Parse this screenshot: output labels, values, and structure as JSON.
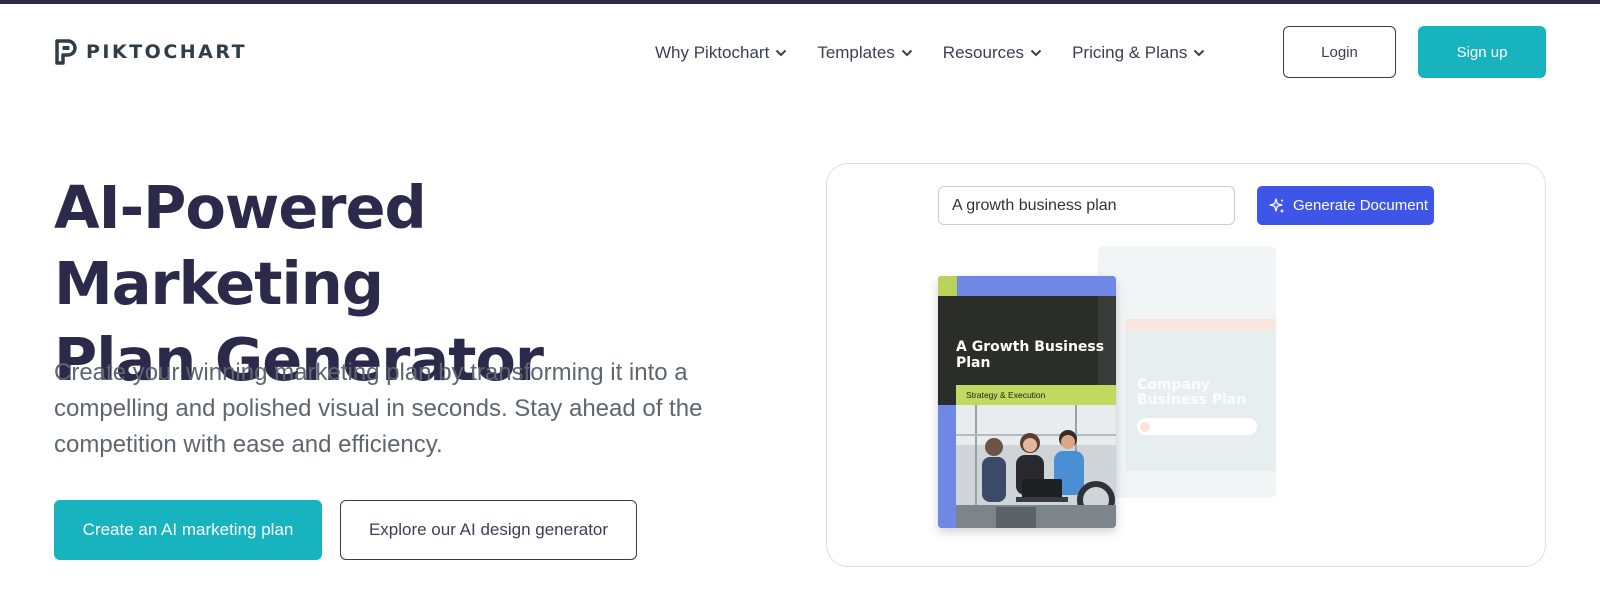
{
  "header": {
    "brand": "PIKTOCHART",
    "nav": [
      {
        "label": "Why Piktochart"
      },
      {
        "label": "Templates"
      },
      {
        "label": "Resources"
      },
      {
        "label": "Pricing & Plans"
      }
    ],
    "login_label": "Login",
    "signup_label": "Sign up"
  },
  "hero": {
    "title_line1": "AI-Powered Marketing",
    "title_line2": "Plan Generator",
    "description": "Create your winning marketing plan by transforming it into a compelling and polished visual in seconds. Stay ahead of the competition with ease and efficiency.",
    "primary_cta": "Create an AI marketing plan",
    "secondary_cta": "Explore our AI design generator"
  },
  "demo": {
    "input_value": "A growth business plan",
    "generate_label": "Generate Document",
    "book": {
      "title": "A Growth Business Plan",
      "subtitle": "Strategy & Execution"
    },
    "ghost_card": {
      "title": "Company Business Plan"
    }
  },
  "colors": {
    "accent_teal": "#17b3bf",
    "accent_blue": "#3d56e8",
    "heading": "#2c2a4a",
    "lime": "#c0d95f",
    "periwinkle": "#6f88e6"
  },
  "icons": [
    "piktochart-logo-icon",
    "chevron-down-icon",
    "sparkle-icon"
  ]
}
